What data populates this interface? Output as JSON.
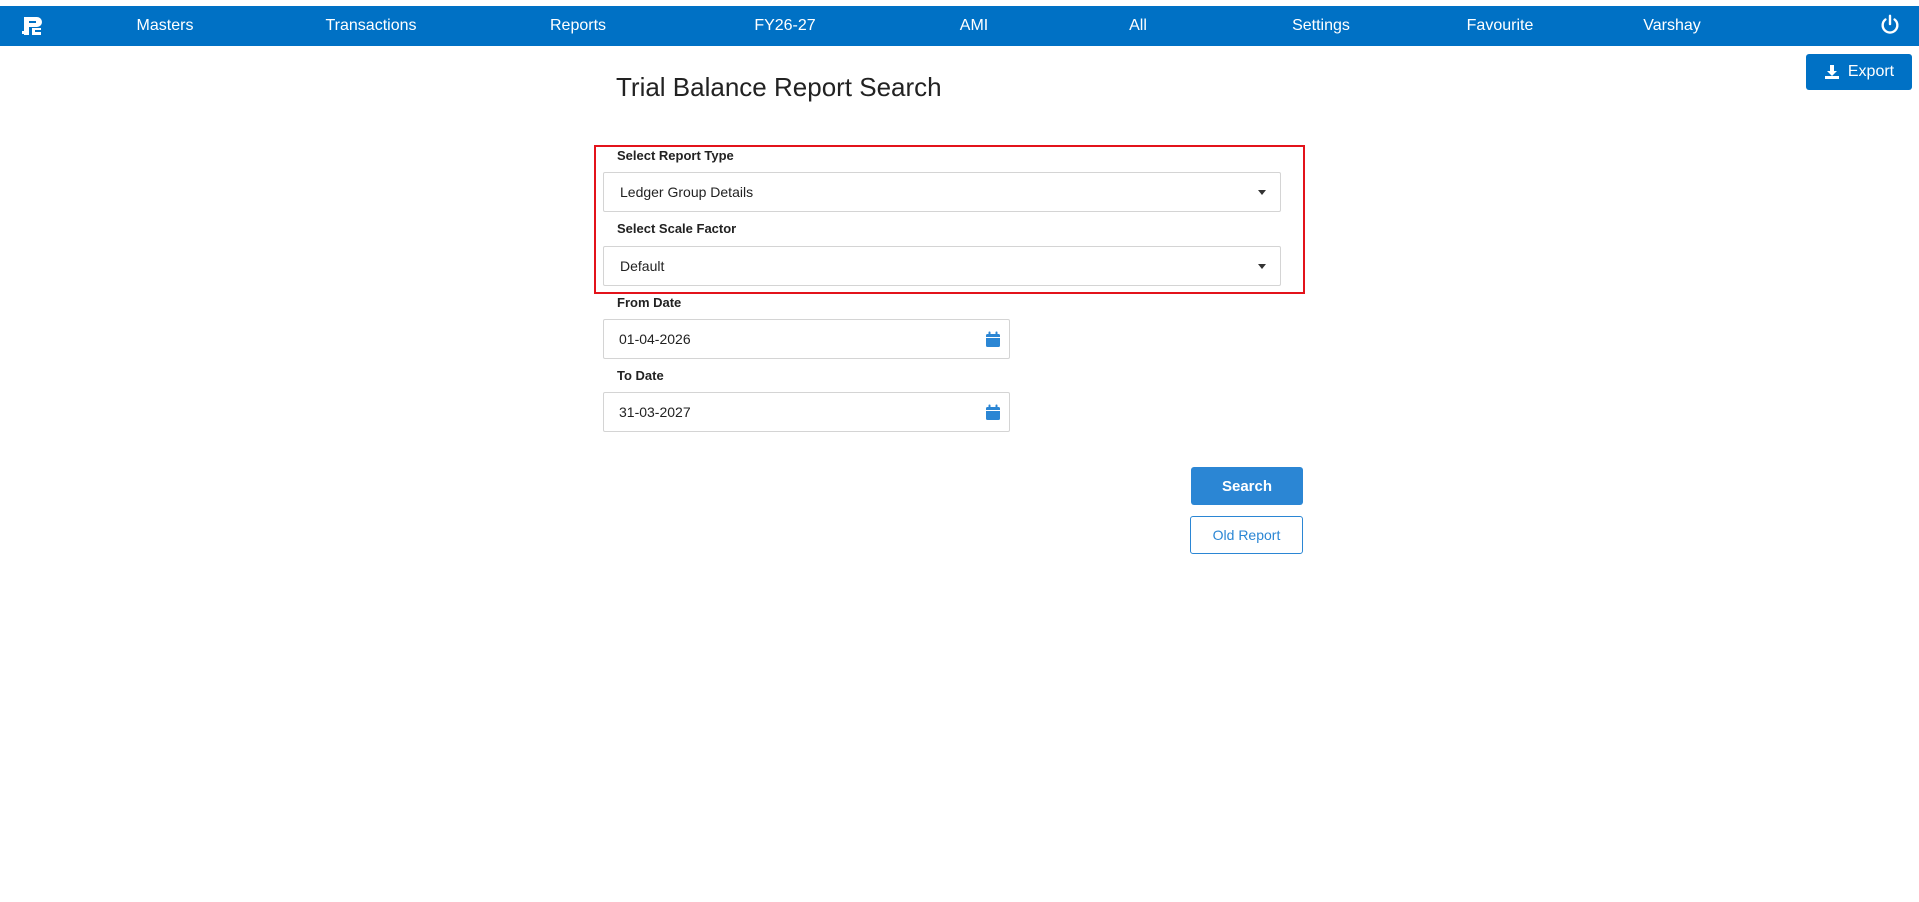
{
  "nav": {
    "items": [
      {
        "key": "masters",
        "label": "Masters"
      },
      {
        "key": "transactions",
        "label": "Transactions"
      },
      {
        "key": "reports",
        "label": "Reports"
      },
      {
        "key": "fy",
        "label": "FY26-27"
      },
      {
        "key": "ami",
        "label": "AMI"
      },
      {
        "key": "all",
        "label": "All"
      },
      {
        "key": "settings",
        "label": "Settings"
      },
      {
        "key": "favourite",
        "label": "Favourite"
      },
      {
        "key": "user",
        "label": "Varshay"
      }
    ],
    "logo_icon": "app-logo-icon",
    "power_icon": "power-icon"
  },
  "toolbar": {
    "export_label": "Export",
    "export_icon": "download-icon"
  },
  "page": {
    "title": "Trial Balance Report Search"
  },
  "form": {
    "report_type": {
      "label": "Select Report Type",
      "value": "Ledger Group Details"
    },
    "scale_factor": {
      "label": "Select Scale Factor",
      "value": "Default"
    },
    "from_date": {
      "label": "From Date",
      "value": "01-04-2026"
    },
    "to_date": {
      "label": "To Date",
      "value": "31-03-2027"
    },
    "search_label": "Search",
    "old_report_label": "Old Report"
  },
  "colors": {
    "primary": "#0071c5",
    "button": "#2b86d4",
    "highlight": "#e3131b"
  }
}
